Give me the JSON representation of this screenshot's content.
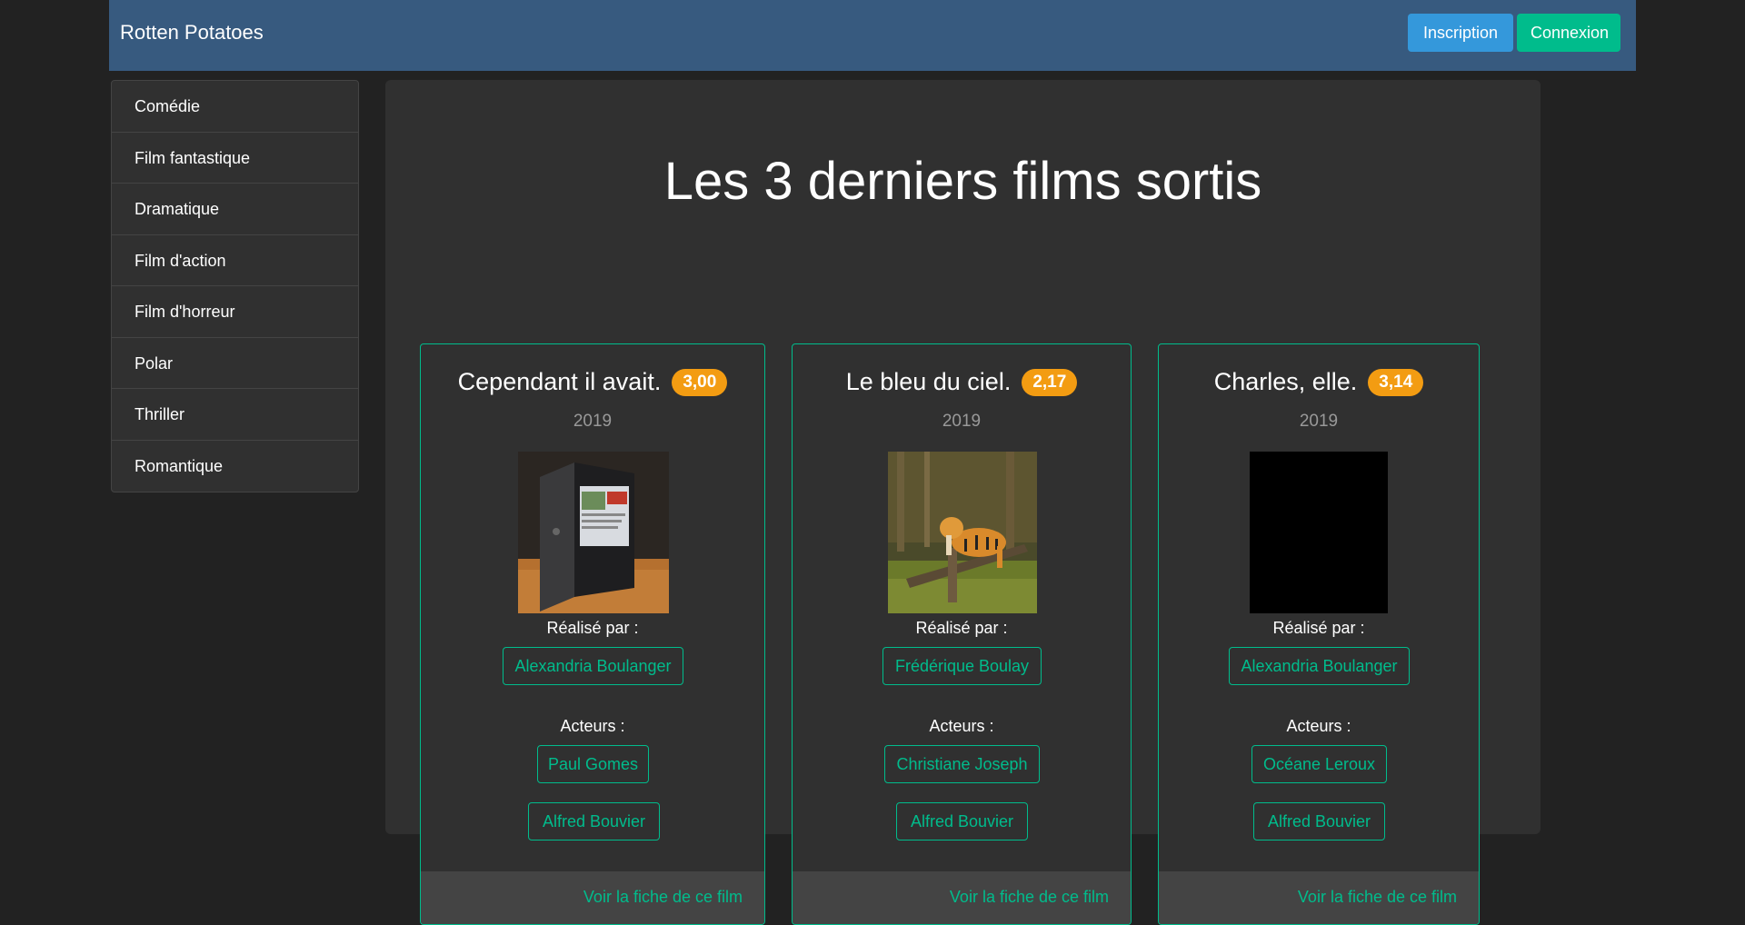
{
  "navbar": {
    "brand": "Rotten Potatoes",
    "signup_label": "Inscription",
    "login_label": "Connexion"
  },
  "sidebar": {
    "items": [
      {
        "label": "Comédie"
      },
      {
        "label": "Film fantastique"
      },
      {
        "label": "Dramatique"
      },
      {
        "label": "Film d'action"
      },
      {
        "label": "Film d'horreur"
      },
      {
        "label": "Polar"
      },
      {
        "label": "Thriller"
      },
      {
        "label": "Romantique"
      }
    ]
  },
  "main": {
    "title": "Les 3 derniers films sortis",
    "directed_by_label": "Réalisé par :",
    "actors_label": "Acteurs :",
    "view_link_label": "Voir la fiche de ce film",
    "films": [
      {
        "title": "Cependant il avait.",
        "rating": "3,00",
        "year": "2019",
        "poster": "laptop-photo",
        "director": "Alexandria Boulanger",
        "actors": [
          "Paul Gomes",
          "Alfred Bouvier"
        ]
      },
      {
        "title": "Le bleu du ciel.",
        "rating": "2,17",
        "year": "2019",
        "poster": "tiger-photo",
        "director": "Frédérique Boulay",
        "actors": [
          "Christiane Joseph",
          "Alfred Bouvier"
        ]
      },
      {
        "title": "Charles, elle.",
        "rating": "3,14",
        "year": "2019",
        "poster": "black-image",
        "director": "Alexandria Boulanger",
        "actors": [
          "Océane Leroux",
          "Alfred Bouvier"
        ]
      }
    ]
  },
  "colors": {
    "background": "#222222",
    "navbar": "#375a7f",
    "accent": "#00bc8c",
    "info": "#3498db",
    "warning": "#f39c12"
  }
}
